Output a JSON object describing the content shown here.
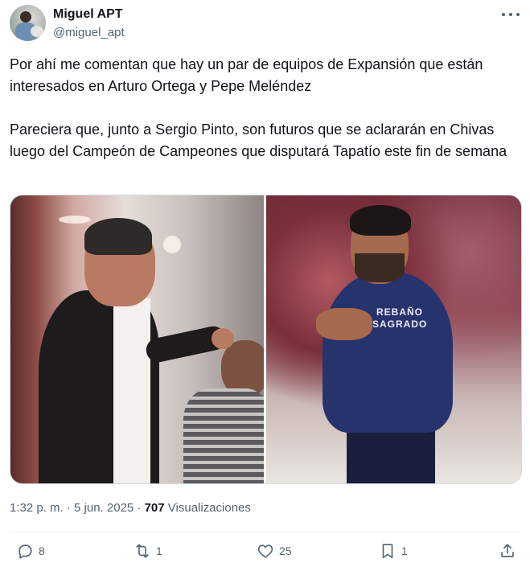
{
  "author": {
    "name": "Miguel APT",
    "handle": "@miguel_apt",
    "avatar_icon": "avatar-photo"
  },
  "tweet": {
    "paragraphs": [
      "Por ahí me comentan que hay un par de equipos de Expansión que están interesados en Arturo Ortega y Pepe Meléndez",
      "Pareciera que, junto a Sergio Pinto, son futuros que se aclararán en Chivas luego del Campeón de Campeones que disputará Tapatío este fin de semana"
    ],
    "media": {
      "right_photo_hoodie_text": "REBAÑO SAGRADO"
    }
  },
  "meta": {
    "timestamp": "1:32 p. m. · 5 jun. 2025 · ",
    "views_count": "707",
    "views_label": " Visualizaciones"
  },
  "actions": {
    "replies": "8",
    "reposts": "1",
    "likes": "25",
    "bookmarks": "1"
  },
  "colors": {
    "text_primary": "#0f1419",
    "text_secondary": "#536471",
    "border": "#cfd9de"
  }
}
